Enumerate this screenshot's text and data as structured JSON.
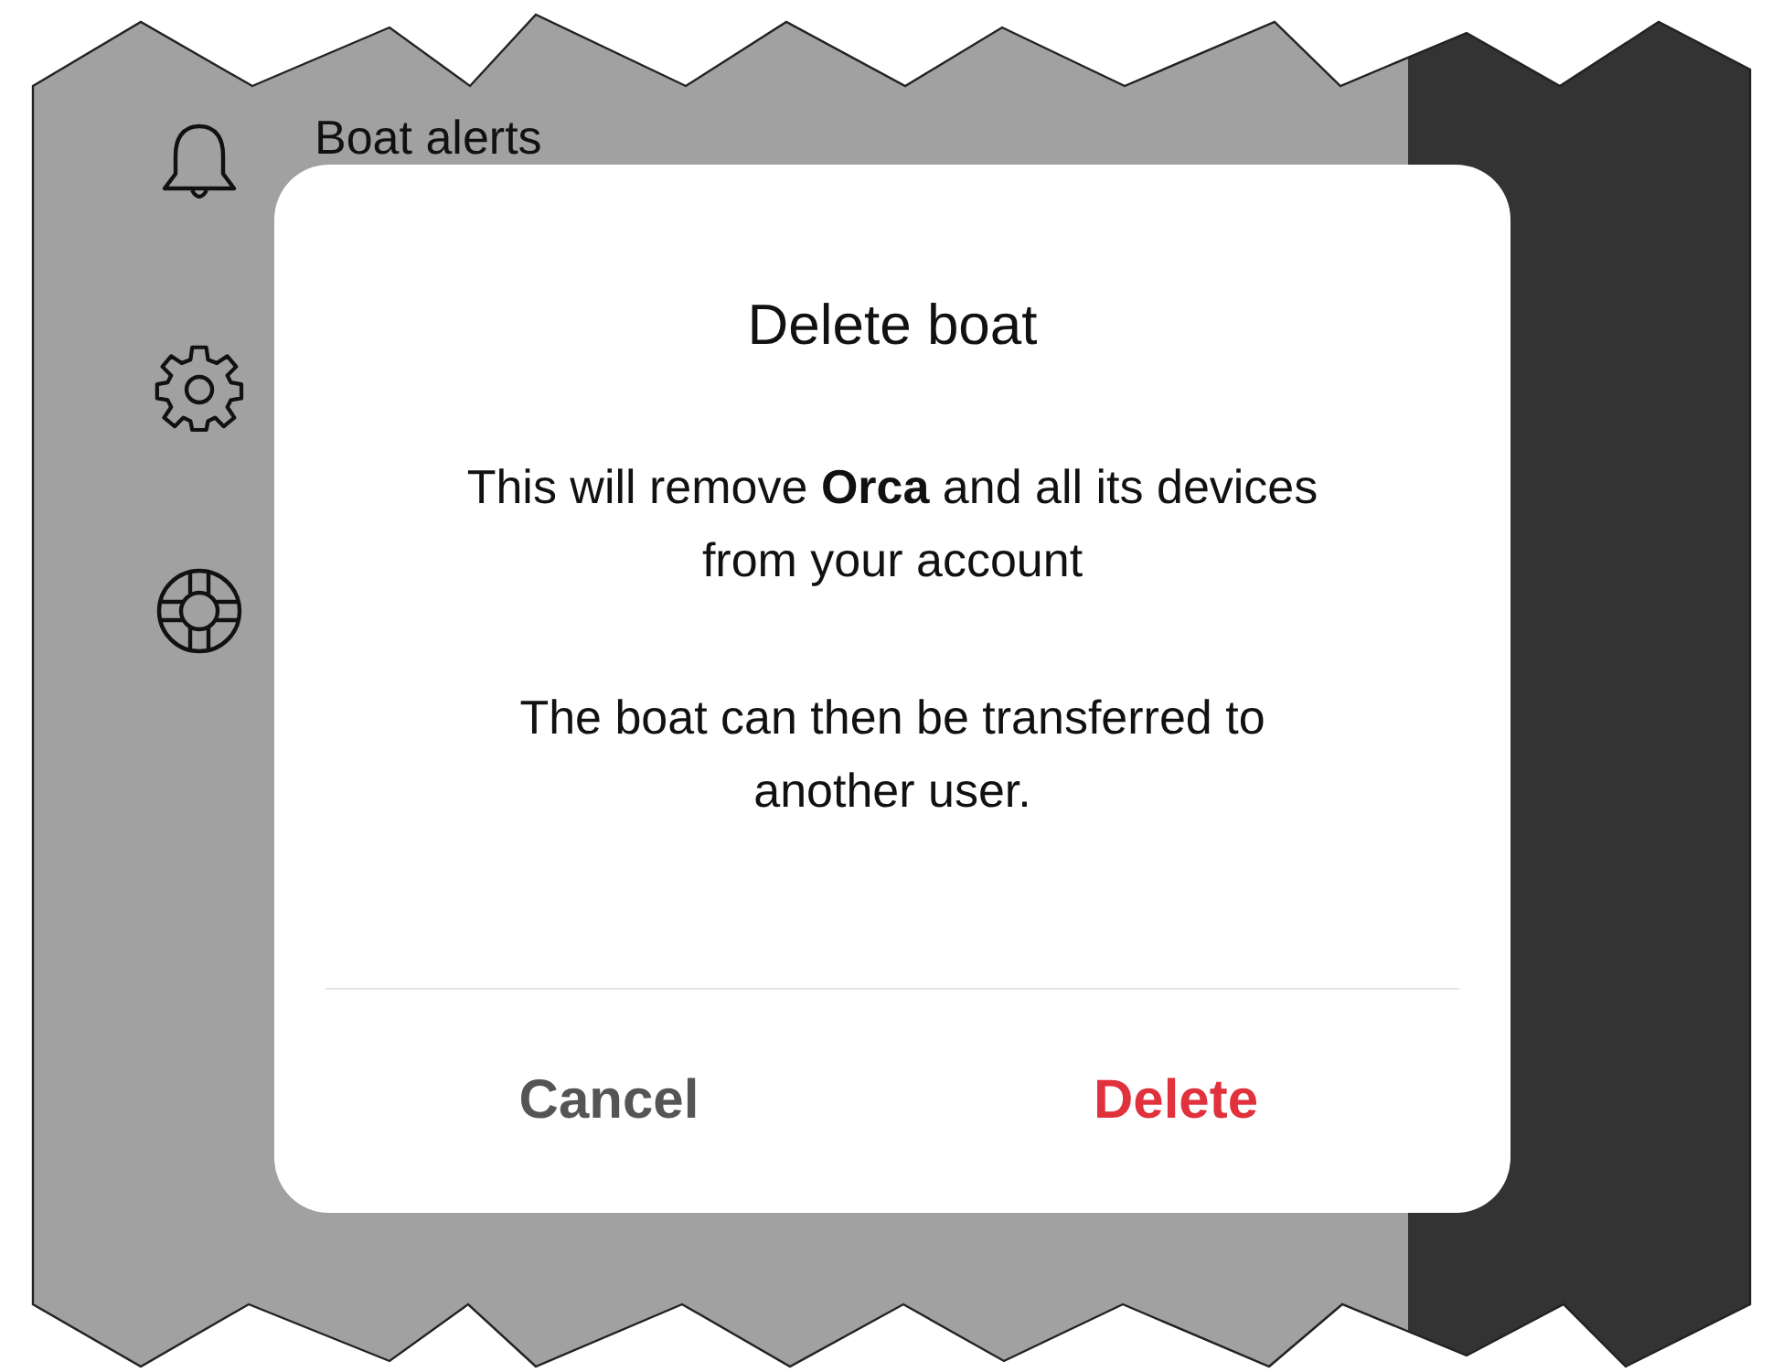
{
  "sidebar": {
    "items": [
      {
        "kind": "bell",
        "label": "Boat alerts"
      },
      {
        "kind": "gear"
      },
      {
        "kind": "lifebuoy"
      }
    ]
  },
  "dialog": {
    "title": "Delete boat",
    "paragraphs": [
      "This will remove **Orca** and all its devices from your account",
      "The boat can then be transferred to another user."
    ],
    "buttons": [
      {
        "kind": "cancel",
        "label": "Cancel"
      },
      {
        "kind": "destructive",
        "label": "Delete"
      }
    ]
  }
}
